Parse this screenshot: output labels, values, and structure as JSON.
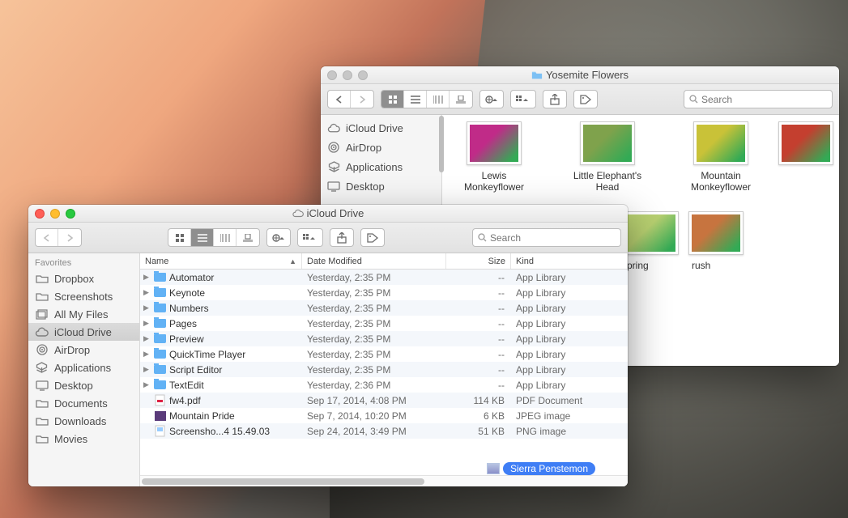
{
  "back_window": {
    "title": "Yosemite Flowers",
    "search_placeholder": "Search",
    "sidebar": [
      {
        "icon": "cloud",
        "label": "iCloud Drive"
      },
      {
        "icon": "airdrop",
        "label": "AirDrop"
      },
      {
        "icon": "apps",
        "label": "Applications"
      },
      {
        "icon": "desktop",
        "label": "Desktop"
      }
    ],
    "items": [
      {
        "label": "Lewis Monkeyflower",
        "color": "#c02b88",
        "selected": false
      },
      {
        "label": "Little Elephant's Head",
        "color": "#7fa24c",
        "selected": false
      },
      {
        "label": "Mountain Monkeyflower",
        "color": "#c9c238",
        "selected": false
      },
      {
        "label": "",
        "color": "#c43f2f",
        "hidden_left": true,
        "selected": false
      },
      {
        "label": "",
        "color": "#9fbf57",
        "hidden_left": true,
        "selected": false
      },
      {
        "label": "Sierra Penstemon",
        "color": "#8a90c9",
        "selected": true
      },
      {
        "label": "pring",
        "color": "#b7cf70",
        "partial": true,
        "selected": false
      },
      {
        "label": "rush",
        "color": "#c7743f",
        "partial": true,
        "selected": false
      }
    ]
  },
  "front_window": {
    "title": "iCloud Drive",
    "search_placeholder": "Search",
    "sidebar_header": "Favorites",
    "sidebar": [
      {
        "icon": "folder",
        "label": "Dropbox",
        "selected": false
      },
      {
        "icon": "folder",
        "label": "Screenshots",
        "selected": false
      },
      {
        "icon": "allfiles",
        "label": "All My Files",
        "selected": false
      },
      {
        "icon": "cloud",
        "label": "iCloud Drive",
        "selected": true
      },
      {
        "icon": "airdrop",
        "label": "AirDrop",
        "selected": false
      },
      {
        "icon": "apps",
        "label": "Applications",
        "selected": false
      },
      {
        "icon": "desktop",
        "label": "Desktop",
        "selected": false
      },
      {
        "icon": "folder",
        "label": "Documents",
        "selected": false
      },
      {
        "icon": "folder",
        "label": "Downloads",
        "selected": false
      },
      {
        "icon": "folder",
        "label": "Movies",
        "selected": false
      }
    ],
    "columns": {
      "name": "Name",
      "modified": "Date Modified",
      "size": "Size",
      "kind": "Kind"
    },
    "rows": [
      {
        "expandable": true,
        "icon": "appfolder",
        "name": "Automator",
        "modified": "Yesterday, 2:35 PM",
        "size": "--",
        "kind": "App Library"
      },
      {
        "expandable": true,
        "icon": "appfolder",
        "name": "Keynote",
        "modified": "Yesterday, 2:35 PM",
        "size": "--",
        "kind": "App Library"
      },
      {
        "expandable": true,
        "icon": "appfolder",
        "name": "Numbers",
        "modified": "Yesterday, 2:35 PM",
        "size": "--",
        "kind": "App Library"
      },
      {
        "expandable": true,
        "icon": "appfolder",
        "name": "Pages",
        "modified": "Yesterday, 2:35 PM",
        "size": "--",
        "kind": "App Library"
      },
      {
        "expandable": true,
        "icon": "appfolder",
        "name": "Preview",
        "modified": "Yesterday, 2:35 PM",
        "size": "--",
        "kind": "App Library"
      },
      {
        "expandable": true,
        "icon": "appfolder",
        "name": "QuickTime Player",
        "modified": "Yesterday, 2:35 PM",
        "size": "--",
        "kind": "App Library"
      },
      {
        "expandable": true,
        "icon": "appfolder",
        "name": "Script Editor",
        "modified": "Yesterday, 2:35 PM",
        "size": "--",
        "kind": "App Library"
      },
      {
        "expandable": true,
        "icon": "appfolder",
        "name": "TextEdit",
        "modified": "Yesterday, 2:36 PM",
        "size": "--",
        "kind": "App Library"
      },
      {
        "expandable": false,
        "icon": "pdf",
        "name": "fw4.pdf",
        "modified": "Sep 17, 2014, 4:08 PM",
        "size": "114 KB",
        "kind": "PDF Document"
      },
      {
        "expandable": false,
        "icon": "jpeg",
        "name": "Mountain Pride",
        "modified": "Sep 7, 2014, 10:20 PM",
        "size": "6 KB",
        "kind": "JPEG image"
      },
      {
        "expandable": false,
        "icon": "png",
        "name": "Screensho...4 15.49.03",
        "modified": "Sep 24, 2014, 3:49 PM",
        "size": "51 KB",
        "kind": "PNG image"
      }
    ],
    "drag_label": "Sierra Penstemon"
  }
}
